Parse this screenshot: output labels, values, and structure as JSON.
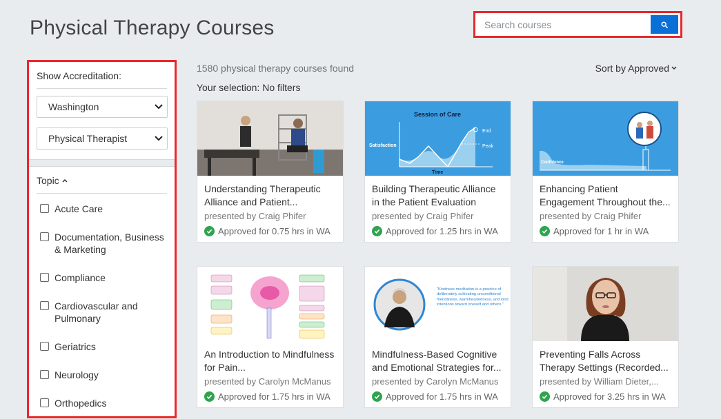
{
  "header": {
    "title": "Physical Therapy Courses"
  },
  "search": {
    "placeholder": "Search courses"
  },
  "sidebar": {
    "accreditation_label": "Show Accreditation:",
    "state_select": "Washington",
    "profession_select": "Physical Therapist",
    "topic_label": "Topic",
    "topics": [
      "Acute Care",
      "Documentation, Business & Marketing",
      "Compliance",
      "Cardiovascular and Pulmonary",
      "Geriatrics",
      "Neurology",
      "Orthopedics"
    ]
  },
  "results": {
    "count_text": "1580 physical therapy courses found",
    "selection_text": "Your selection: No filters",
    "sort_label": "Sort by Approved"
  },
  "thumb_text": {
    "session_of_care": "Session of Care",
    "satisfaction": "Satisfaction",
    "time": "Time",
    "end": "End",
    "peak": "Peak",
    "confidence": "Confidence",
    "kindness_quote": "\"Kindness meditation is a practice of deliberately cultivating unconditional friendliness, warmheartedness, and kind intentions toward oneself and others.\""
  },
  "courses": [
    {
      "title": "Understanding Therapeutic Alliance and Patient...",
      "presenter": "presented by Craig Phifer",
      "approval": "Approved for 0.75 hrs in WA"
    },
    {
      "title": "Building Therapeutic Alliance in the Patient Evaluation",
      "presenter": "presented by Craig Phifer",
      "approval": "Approved for 1.25 hrs in WA"
    },
    {
      "title": "Enhancing Patient Engagement Throughout the...",
      "presenter": "presented by Craig Phifer",
      "approval": "Approved for 1 hr in WA"
    },
    {
      "title": "An Introduction to Mindfulness for Pain...",
      "presenter": "presented by Carolyn McManus",
      "approval": "Approved for 1.75 hrs in WA"
    },
    {
      "title": "Mindfulness-Based Cognitive and Emotional Strategies for...",
      "presenter": "presented by Carolyn McManus",
      "approval": "Approved for 1.75 hrs in WA"
    },
    {
      "title": "Preventing Falls Across Therapy Settings (Recorded...",
      "presenter": "presented by William Dieter,...",
      "approval": "Approved for 3.25 hrs in WA"
    }
  ],
  "colors": {
    "accent": "#0a6fd6",
    "highlight": "#e8282b",
    "approved": "#2ea44f"
  }
}
